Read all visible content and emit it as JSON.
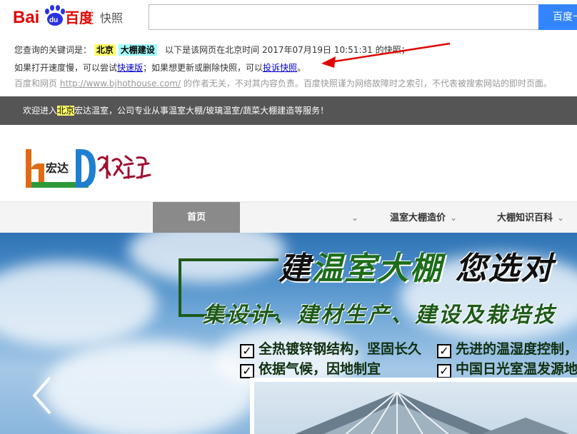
{
  "baidu": {
    "logo_text": "Bai百度",
    "kuaizhao": "快照",
    "search_value": "",
    "search_button": "百度一下",
    "line1": {
      "prefix": "您查询的关键词是：",
      "keyword1": "北京",
      "keyword2": "大棚建设",
      "suffix": "以下是该网页在北京时间 2017年07月19日 10:51:31 的快照；"
    },
    "line2": {
      "prefix": "如果打开速度慢，可以尝试",
      "fast_link": "快速版",
      "middle": "；如果想更新或删除快照，可以",
      "complaint_link": "投诉快照",
      "end": "。"
    },
    "line3": {
      "prefix": "百度和网页",
      "url": "http://www.bjhothouse.com/",
      "suffix": "的作者无关，不对其内容负责。百度快照谨为网络故障时之索引，不代表被搜索网站的即时页面。"
    }
  },
  "site": {
    "welcome": {
      "pre": "欢迎进入",
      "highlight": "北京",
      "post": "宏达温室，公司专业从事温室大棚/玻璃温室/蔬菜大棚建造等服务！"
    },
    "logo_text": "宏达",
    "nav": {
      "home": "首页",
      "item2": "温室大棚造价",
      "item3": "大棚知识百科"
    },
    "banner": {
      "title_a": "建",
      "title_b": "温室大棚",
      "title_c": "您选对",
      "subtitle": "集设计、建材生产、建设及栽培技",
      "features": [
        "全热镀锌钢结构，坚固长久",
        "先进的温湿度控制，",
        "依据气候，因地制宜",
        "中国日光室温发源地"
      ]
    }
  },
  "colors": {
    "baidu_blue": "#3385ff",
    "baidu_red": "#e10601",
    "link": "#0000cc",
    "keyword1_bg": "#ffff66",
    "keyword2_bg": "#a0ffff",
    "welcome_bg": "#555555",
    "nav_active": "#8a8a8a",
    "banner_green": "#1e5a1a"
  }
}
